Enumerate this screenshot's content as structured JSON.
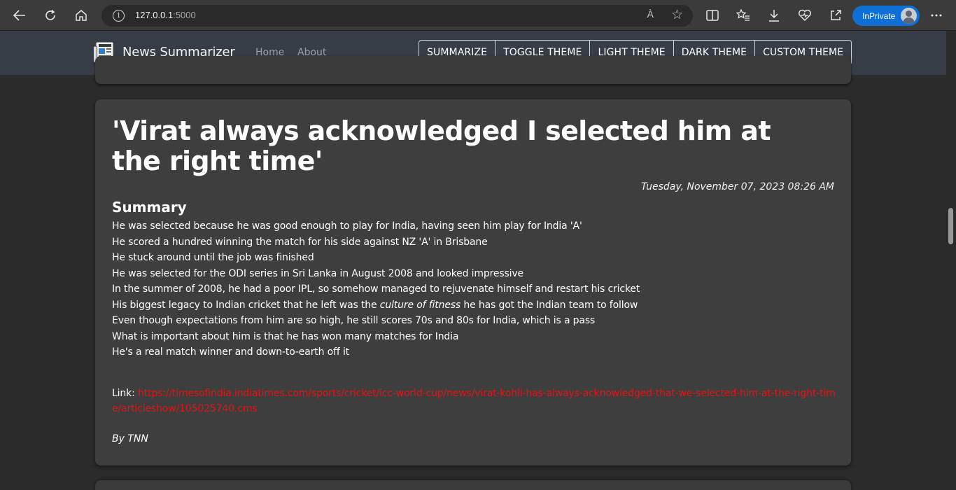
{
  "browser": {
    "url_host": "127.0.0.1",
    "url_port": ":5000",
    "read_aloud": "À",
    "inprivate_label": "InPrivate"
  },
  "navbar": {
    "brand": "News Summarizer",
    "links": [
      "Home",
      "About"
    ],
    "buttons": [
      "SUMMARIZE",
      "TOGGLE THEME",
      "LIGHT THEME",
      "DARK THEME",
      "CUSTOM THEME"
    ]
  },
  "article": {
    "title": "'Virat always acknowledged I selected him at the right time'",
    "date": "Tuesday, November 07, 2023 08:26 AM",
    "summary_heading": "Summary",
    "points": [
      "He was selected because he was good enough to play for India, having seen him play for India 'A'",
      "He scored a hundred winning the match for his side against NZ 'A' in Brisbane",
      "He stuck around until the job was finished",
      "He was selected for the ODI series in Sri Lanka in August 2008 and looked impressive",
      "In the summer of 2008, he had a poor IPL, so somehow managed to rejuvenate himself and restart his cricket"
    ],
    "legacy_before": "His biggest legacy to Indian cricket that he left was the ",
    "legacy_em": "culture of fitness",
    "legacy_after": " he has got the Indian team to follow",
    "points_after": [
      "Even though expectations from him are so high, he still scores 70s and 80s for India, which is a pass",
      "What is important about him is that he has won many matches for India",
      "He's a real match winner and down-to-earth off it"
    ],
    "link_label": "Link:",
    "link_url": "https://timesofindia.indiatimes.com/sports/cricket/icc-world-cup/news/virat-kohli-has-always-acknowledged-that-we-selected-him-at-the-right-time/articleshow/105025740.cms",
    "byline": "By TNN"
  },
  "colors": {
    "page_bg": "#2b2b2b",
    "navbar_bg": "#373d46",
    "card_bg": "#3e3e3e",
    "link": "#e01515",
    "inprivate": "#0e6fd6"
  },
  "icons": [
    "back-arrow-icon",
    "refresh-icon",
    "home-icon",
    "info-icon",
    "read-aloud-icon",
    "favorite-star-icon",
    "split-screen-icon",
    "favorites-list-icon",
    "download-icon",
    "browser-essentials-icon",
    "share-icon",
    "more-icon",
    "newspaper-icon"
  ]
}
